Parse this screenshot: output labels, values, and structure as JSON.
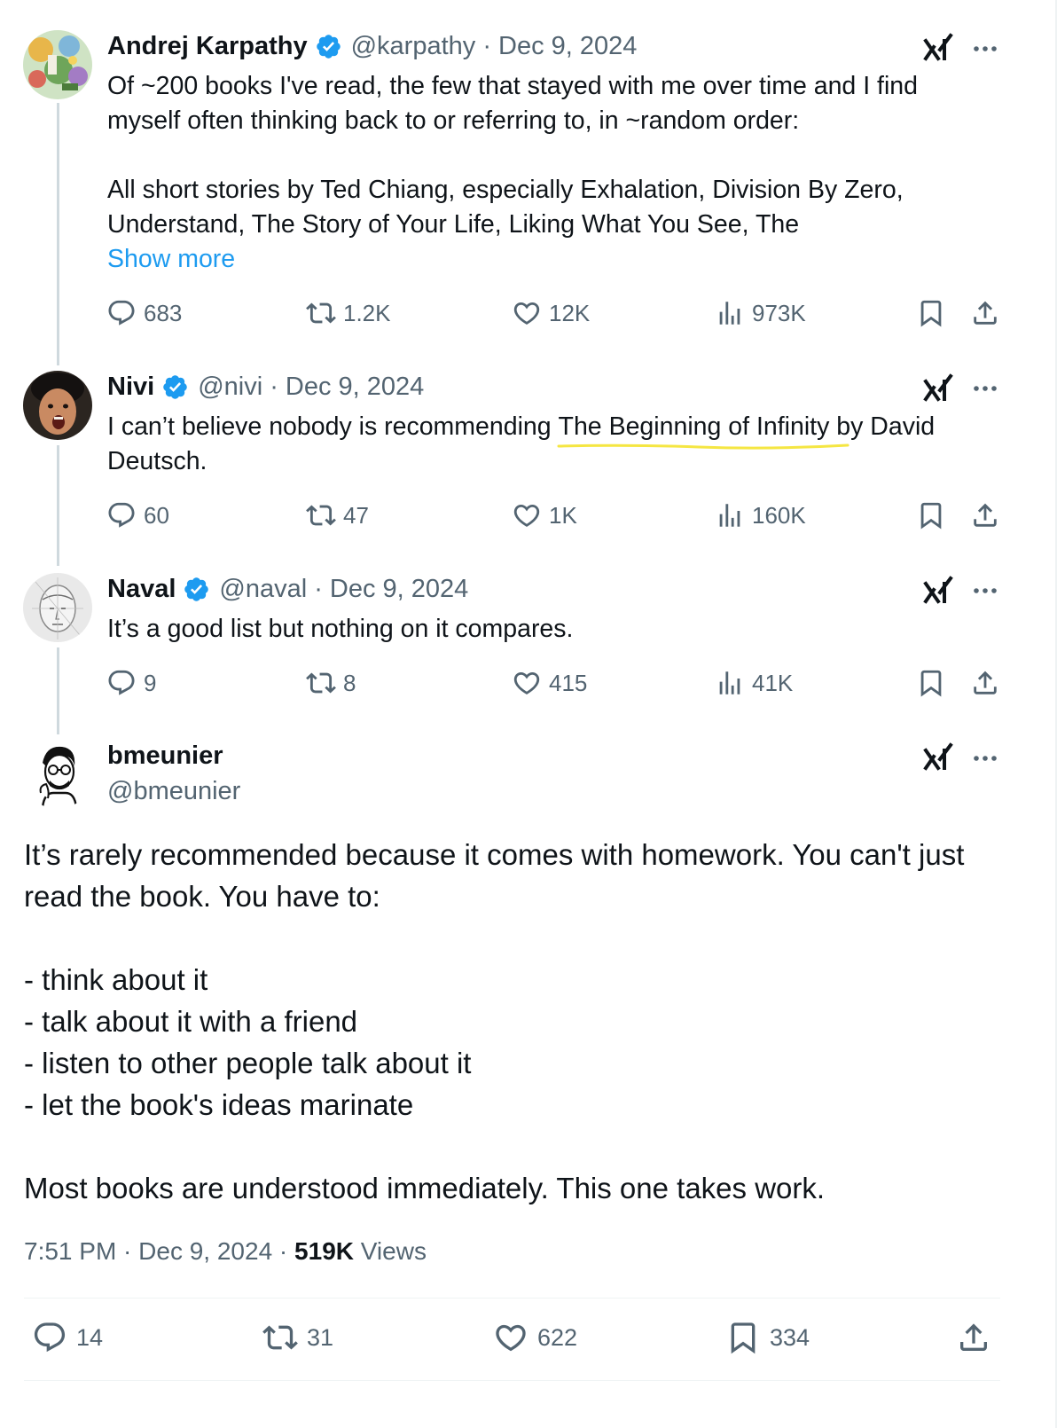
{
  "thread": [
    {
      "display_name": "Andrej Karpathy",
      "handle_meta": "@karpathy · Dec 9, 2024",
      "lines": [
        "Of ~200 books I've read, the few that stayed with me over time and I find",
        "myself often thinking back to or referring to, in ~random order:",
        "All short stories by Ted Chiang, especially Exhalation, Division By Zero,",
        "Understand, The Story of Your Life, Liking What You See, The"
      ],
      "show_more": "Show more",
      "stats": {
        "replies": "683",
        "reposts": "1.2K",
        "likes": "12K",
        "views": "973K"
      }
    },
    {
      "display_name": "Nivi",
      "handle_meta": "@nivi · Dec 9, 2024",
      "line1_before": "I can’t believe nobody is recommending ",
      "line1_highlight": "The Beginning of Infinity",
      "line1_after": " by David",
      "line2": "Deutsch.",
      "stats": {
        "replies": "60",
        "reposts": "47",
        "likes": "1K",
        "views": "160K"
      }
    },
    {
      "display_name": "Naval",
      "handle_meta": "@naval · Dec 9, 2024",
      "line1": "It’s a good list but nothing on it compares.",
      "stats": {
        "replies": "9",
        "reposts": "8",
        "likes": "415",
        "views": "41K"
      }
    }
  ],
  "main_post": {
    "display_name": "bmeunier",
    "handle": "@bmeunier",
    "lines": [
      "It’s rarely recommended because it comes with homework. You can't just",
      "read the book. You have to:",
      "- think about it",
      "- talk about it with a friend",
      "- listen to other people talk about it",
      "- let the book's ideas marinate",
      "Most books are understood immediately. This one takes work."
    ],
    "timestamp": "7:51 PM · Dec 9, 2024 · ",
    "views_count": "519K",
    "views_label": " Views",
    "stats": {
      "replies": "14",
      "reposts": "31",
      "likes": "622",
      "bookmarks": "334"
    }
  },
  "colors": {
    "verified": "#1d9bf0",
    "link": "#1d9bf0",
    "muted": "#536471",
    "text": "#0f1419",
    "highlight": "#f5e642",
    "thread_line": "#cfd9de"
  },
  "icons": [
    "verified-badge-icon",
    "grok-icon",
    "more-icon",
    "reply-icon",
    "repost-icon",
    "like-icon",
    "views-icon",
    "bookmark-icon",
    "share-icon"
  ]
}
